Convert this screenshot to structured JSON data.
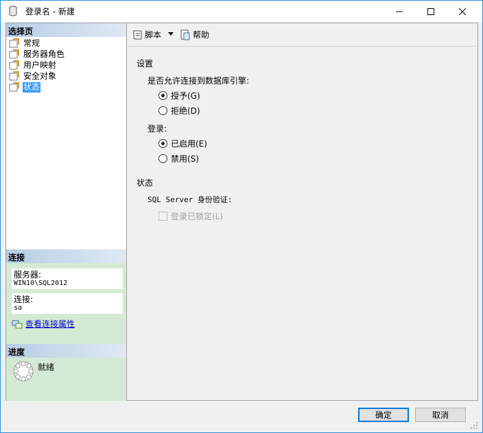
{
  "window": {
    "title": "登录名 - 新建"
  },
  "left": {
    "select_page_header": "选择页",
    "nav_items": [
      {
        "label": "常规"
      },
      {
        "label": "服务器角色"
      },
      {
        "label": "用户映射"
      },
      {
        "label": "安全对象"
      },
      {
        "label": "状态"
      }
    ],
    "connection_header": "连接",
    "server_label": "服务器:",
    "server_value": "WIN10\\SQL2012",
    "connection_label": "连接:",
    "connection_value": "sa",
    "view_connection_link": "查看连接属性",
    "progress_header": "进度",
    "progress_status": "就绪"
  },
  "toolbar": {
    "script_label": "脚本",
    "help_label": "帮助"
  },
  "content": {
    "settings_heading": "设置",
    "permission_question": "是否允许连接到数据库引擎:",
    "grant_label": "授予(G)",
    "deny_label": "拒绝(D)",
    "login_label": "登录:",
    "enabled_label": "已启用(E)",
    "disabled_label": "禁用(S)",
    "status_heading": "状态",
    "sql_auth_label": "SQL Server 身份验证:",
    "locked_label": "登录已锁定(L)"
  },
  "buttons": {
    "ok_label": "确定",
    "cancel_label": "取消"
  },
  "colors": {
    "accent": "#0078d7",
    "selection": "#3399ff",
    "connection_bg": "#d4ead4",
    "link": "#0000cc"
  }
}
